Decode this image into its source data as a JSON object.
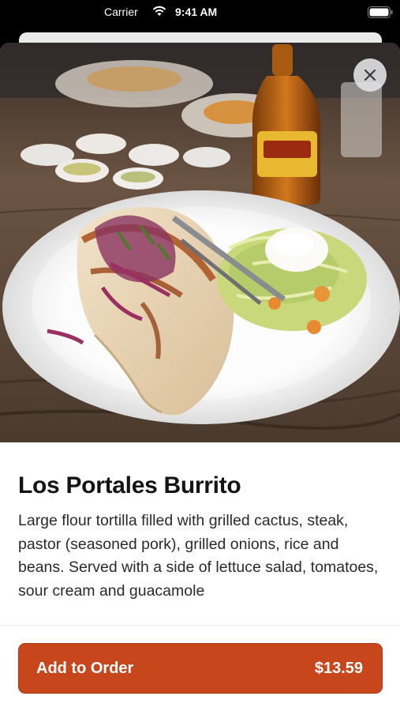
{
  "status_bar": {
    "carrier": "Carrier",
    "time": "9:41 AM",
    "wifi_icon": "wifi-icon",
    "battery_icon": "battery-icon"
  },
  "hero": {
    "image": "burrito-plate-photo",
    "bottle_label": "Cholula"
  },
  "close": {
    "icon": "close-icon"
  },
  "dish": {
    "name": "Los Portales Burrito",
    "description": "Large flour tortilla filled with grilled cactus, steak, pastor (seasoned pork), grilled onions, rice and beans. Served with a side of lettuce salad, tomatoes, sour cream and guacamole"
  },
  "order": {
    "label": "Add to Order",
    "price": "$13.59"
  },
  "colors": {
    "accent": "#c8461c",
    "text": "#141414",
    "background": "#ffffff"
  }
}
